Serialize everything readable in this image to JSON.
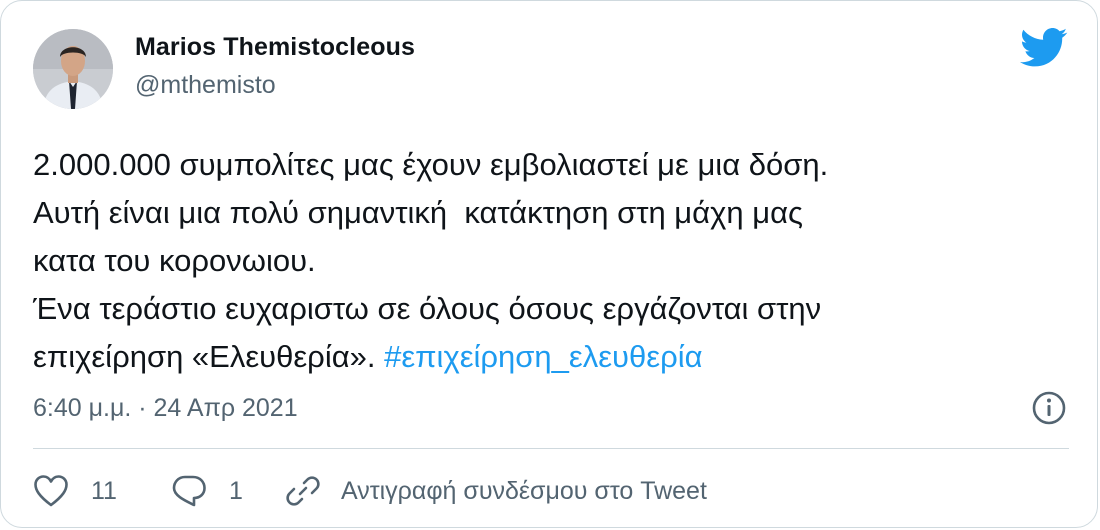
{
  "author": {
    "name": "Marios Themistocleous",
    "handle": "@mthemisto"
  },
  "tweet": {
    "line1": "2.000.000 συμπολίτες μας έχουν εμβολιαστεί με μια δόση.",
    "line2": "Αυτή είναι μια πολύ σημαντική  κατάκτηση στη μάχη μας",
    "line3": "κατα του κορονωιου.",
    "line4": "Ένα τεράστιο ευχαριστω σε όλους όσους εργάζονται στην",
    "line5_text": "επιχείρηση «Ελευθερία». ",
    "hashtag": "#επιχείρηση_ελευθερία"
  },
  "meta": {
    "timestamp": "6:40 μ.μ. · 24 Απρ 2021"
  },
  "actions": {
    "like_count": "11",
    "reply_count": "1",
    "copy_link_label": "Αντιγραφή συνδέσμου στο Tweet"
  },
  "icons": {
    "brand": "twitter-bird-icon",
    "info": "info-icon",
    "like": "heart-icon",
    "reply": "speech-bubble-icon",
    "link": "link-icon"
  },
  "colors": {
    "brand_blue": "#1d9bf0",
    "text_primary": "#0f1419",
    "text_secondary": "#536471",
    "border": "#cfd9de"
  }
}
